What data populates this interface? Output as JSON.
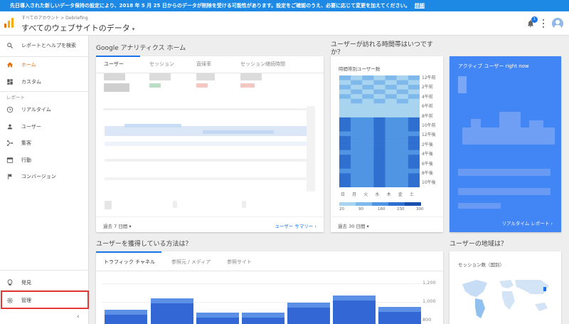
{
  "banner": {
    "text": "先日導入された新しいデータ保持の設定により、2018 年 5 月 25 日からのデータが削除を受ける可能性があります。設定をご確認のうえ、必要に応じて変更を加えてください。",
    "link": "詳細"
  },
  "header": {
    "breadcrumb": "すべてのアカウント > Debriefing",
    "view_title": "すべてのウェブサイトのデータ",
    "notification_count": "1"
  },
  "sidebar": {
    "search": "レポートとヘルプを検索",
    "home": "ホーム",
    "custom": "カスタム",
    "reports_section": "レポート",
    "realtime": "リアルタイム",
    "audience": "ユーザー",
    "acquisition": "集客",
    "behavior": "行動",
    "conversions": "コンバージョン",
    "discover": "発見",
    "admin": "管理",
    "collapse": "‹"
  },
  "home_card": {
    "title": "Google アナリティクス ホーム",
    "tabs": [
      "ユーザー",
      "セッション",
      "直帰率",
      "セッション継続時間"
    ],
    "date_range": "過去 7 日間",
    "summary_link": "ユーザー サマリー"
  },
  "heatmap_card": {
    "title": "ユーザーが訪れる時間帯はいつですか？",
    "subtitle": "時間帯別ユーザー数",
    "hour_labels": [
      "12午前",
      "2午前",
      "4午前",
      "6午前",
      "8午前",
      "10午前",
      "12午後",
      "2午後",
      "4午後",
      "6午後",
      "8午後",
      "10午後"
    ],
    "day_labels": [
      "日",
      "月",
      "火",
      "水",
      "木",
      "金",
      "土"
    ],
    "scale_labels": [
      "20",
      "90",
      "160",
      "230",
      "300"
    ],
    "scale_colors": [
      "#a8d4f0",
      "#7fb9ec",
      "#4f95e4",
      "#2f6fd0",
      "#1a4fb0"
    ],
    "date_range": "過去 30 日間"
  },
  "realtime_card": {
    "title": "アクティブ ユーザー right now",
    "link": "リアルタイム レポート",
    "color": "#4285f4"
  },
  "acquisition_card": {
    "title": "ユーザーを獲得している方法は？",
    "tabs": [
      "トラフィック チャネル",
      "参照元 / メディア",
      "参照サイト"
    ],
    "y_axis_labels": [
      "1,200",
      "1,000",
      "800"
    ]
  },
  "geo_card": {
    "title": "ユーザーの地域は？",
    "subtitle": "セッション数（国別）"
  }
}
